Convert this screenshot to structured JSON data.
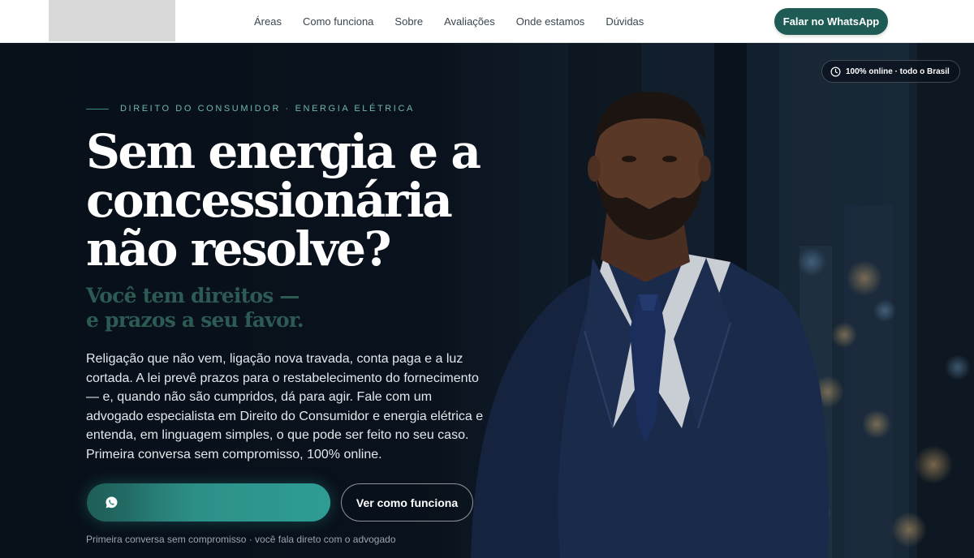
{
  "header": {
    "nav": [
      {
        "label": "Áreas"
      },
      {
        "label": "Como funciona"
      },
      {
        "label": "Sobre"
      },
      {
        "label": "Avaliações"
      },
      {
        "label": "Onde estamos"
      },
      {
        "label": "Dúvidas"
      }
    ],
    "cta_label": "Falar no WhatsApp"
  },
  "hero": {
    "badge": "100% online · todo o Brasil",
    "eyebrow": "DIREITO DO CONSUMIDOR · ENERGIA ELÉTRICA",
    "headline": [
      "Sem energia e a",
      "concessionária",
      "não resolve?"
    ],
    "subhead": [
      "Você tem direitos —",
      "e prazos a seu favor."
    ],
    "body": "Religação que não vem, ligação nova travada, conta paga e a luz cortada. A lei prevê prazos para o restabelecimento do fornecimento — e, quando não são cumpridos, dá para agir. Fale com um advogado especialista em Direito do Consumidor e energia elétrica e entenda, em linguagem simples, o que pode ser feito no seu caso. Primeira conversa sem compromisso, 100% online.",
    "cta_primary_label": "",
    "cta_secondary_label": "Ver como funciona",
    "footnote": "Primeira conversa sem compromisso · você fala direto com o advogado"
  },
  "colors": {
    "accent": "#1f5b55",
    "accent_light": "#2f9d94",
    "eyebrow": "#6fb7ac",
    "subhead": "#2f5e56",
    "hero_bg": "#0a1420"
  },
  "icons": {
    "badge": "clock-icon",
    "cta_primary": "whatsapp-icon"
  }
}
